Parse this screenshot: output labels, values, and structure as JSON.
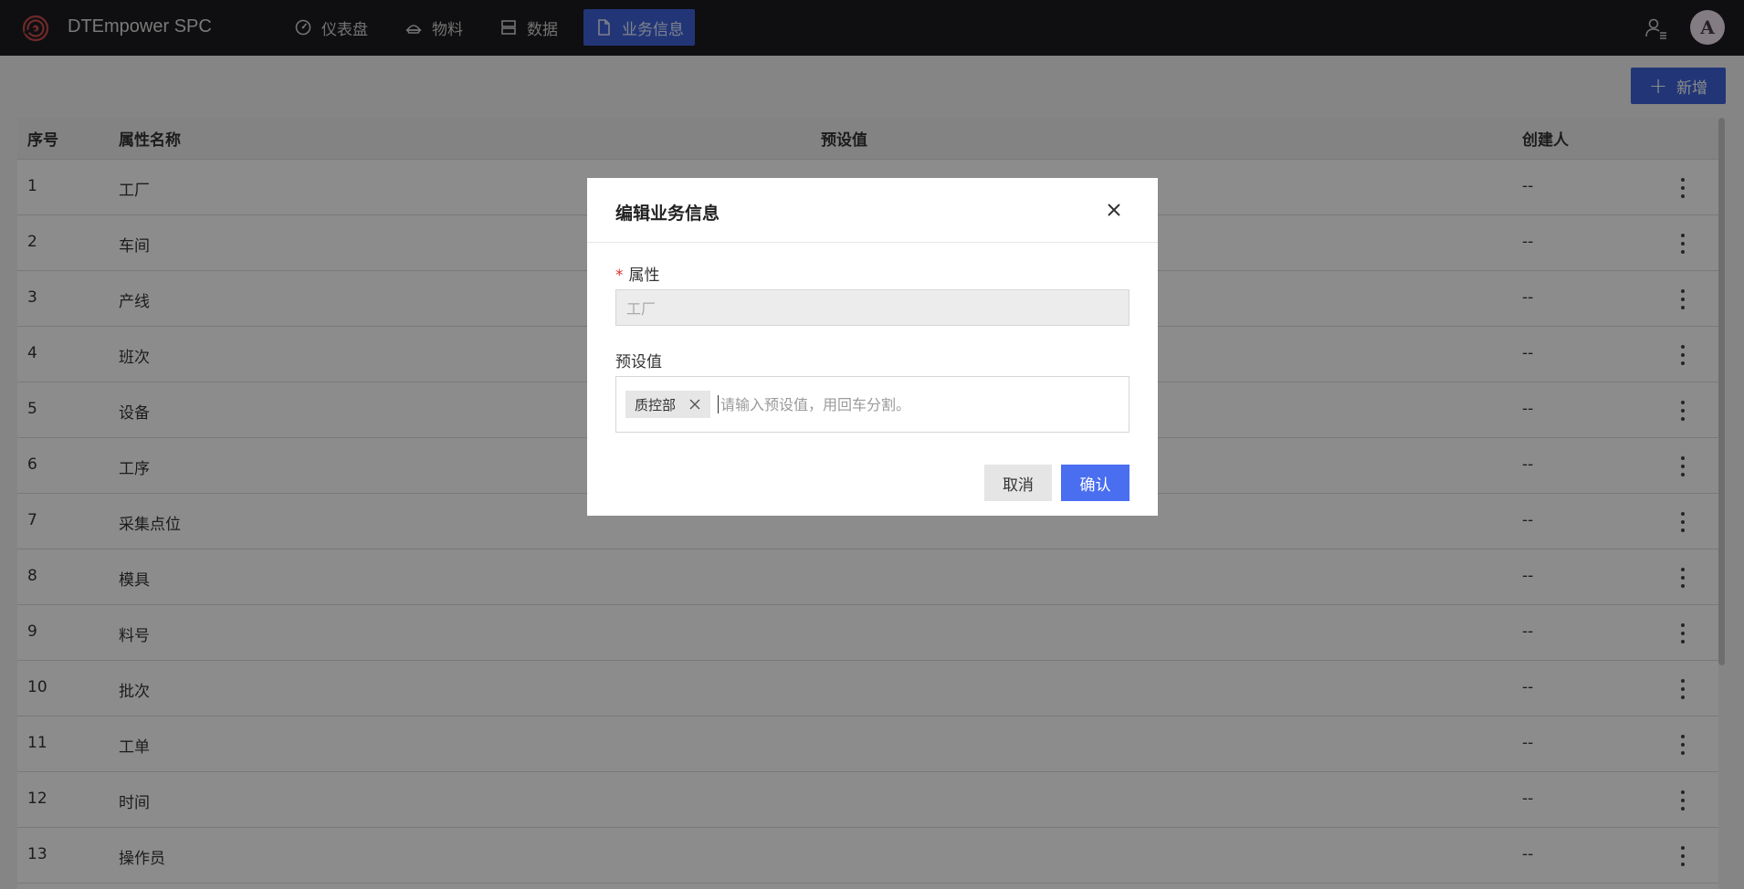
{
  "app": {
    "title": "DTEmpower SPC",
    "avatar_letter": "A"
  },
  "nav": [
    {
      "label": "仪表盘",
      "icon": "gauge-icon",
      "active": false
    },
    {
      "label": "物料",
      "icon": "material-icon",
      "active": false
    },
    {
      "label": "数据",
      "icon": "data-icon",
      "active": false
    },
    {
      "label": "业务信息",
      "icon": "document-icon",
      "active": true
    }
  ],
  "toolbar": {
    "add_label": "新增"
  },
  "table": {
    "headers": {
      "seq": "序号",
      "name": "属性名称",
      "preset": "预设值",
      "creator": "创建人"
    },
    "rows": [
      {
        "seq": "1",
        "name": "工厂",
        "creator": "--"
      },
      {
        "seq": "2",
        "name": "车间",
        "creator": "--"
      },
      {
        "seq": "3",
        "name": "产线",
        "creator": "--"
      },
      {
        "seq": "4",
        "name": "班次",
        "creator": "--"
      },
      {
        "seq": "5",
        "name": "设备",
        "creator": "--"
      },
      {
        "seq": "6",
        "name": "工序",
        "creator": "--"
      },
      {
        "seq": "7",
        "name": "采集点位",
        "creator": "--"
      },
      {
        "seq": "8",
        "name": "模具",
        "creator": "--"
      },
      {
        "seq": "9",
        "name": "料号",
        "creator": "--"
      },
      {
        "seq": "10",
        "name": "批次",
        "creator": "--"
      },
      {
        "seq": "11",
        "name": "工单",
        "creator": "--"
      },
      {
        "seq": "12",
        "name": "时间",
        "creator": "--"
      },
      {
        "seq": "13",
        "name": "操作员",
        "creator": "--"
      }
    ]
  },
  "modal": {
    "title": "编辑业务信息",
    "attr_required_mark": "*",
    "attr_label": "属性",
    "attr_value": "工厂",
    "preset_label": "预设值",
    "tags": [
      "质控部"
    ],
    "preset_placeholder": "请输入预设值，用回车分割。",
    "cancel_label": "取消",
    "confirm_label": "确认"
  },
  "colors": {
    "accent": "#3f63d9",
    "confirm": "#4a6ef0",
    "topbar": "#1d1d1f"
  }
}
